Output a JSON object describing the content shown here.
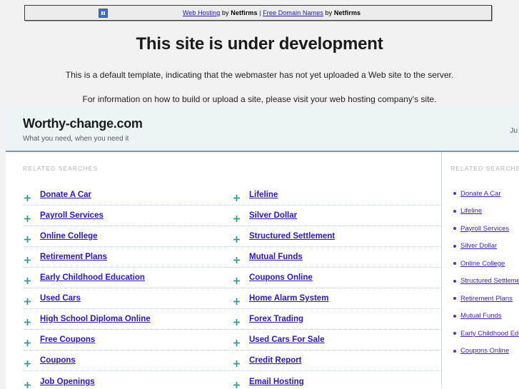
{
  "banner": {
    "icon": "broken-image-icon",
    "link1_text": "Web Hosting",
    "by1": " by ",
    "brand1": "Netfirms",
    "separator": " | ",
    "link2_text": "Free Domain Names",
    "by2": " by ",
    "brand2": "Netfirms"
  },
  "notice": {
    "title": "This site is under development",
    "line1": "This is a default template, indicating that the webmaster has not yet uploaded a Web site to the server.",
    "line2": "For information on how to build or upload a site, please visit your web hosting company's site."
  },
  "parked": {
    "domain": "Worthy-change.com",
    "tagline": "What you need, when you need it",
    "header_right": "Ju",
    "main_section_label": "RELATED SEARCHES",
    "side_section_label": "RELATED SEARCHES",
    "main_links_left": [
      "Donate A Car",
      "Payroll Services",
      "Online College",
      "Retirement Plans",
      "Early Childhood Education",
      "Used Cars",
      "High School Diploma Online",
      "Free Coupons",
      "Coupons",
      "Job Openings"
    ],
    "main_links_right": [
      "Lifeline",
      "Silver Dollar",
      "Structured Settlement",
      "Mutual Funds",
      "Coupons Online",
      "Home Alarm System",
      "Forex Trading",
      "Used Cars For Sale",
      "Credit Report",
      "Email Hosting"
    ],
    "side_links": [
      "Donate A Car",
      "Lifeline",
      "Payroll Services",
      "Silver Dollar",
      "Online College",
      "Structured Settlement",
      "Retirement Plans",
      "Mutual Funds",
      "Early Childhood Education",
      "Coupons Online"
    ]
  },
  "colors": {
    "page_bg": "#f2f2f2",
    "banner_bg": "#ececec",
    "banner_border": "#3b3b3b",
    "link_blue": "#1a13c4",
    "parked_header_bg": "#edf4f5",
    "parked_header_border": "#7d93c8",
    "main_link": "#2a14cf",
    "bullet_green": "#2f9e8f",
    "bullet_purple": "#4b2fd0",
    "row_divider": "#c9d4e2",
    "section_label": "#b6b6b6"
  }
}
